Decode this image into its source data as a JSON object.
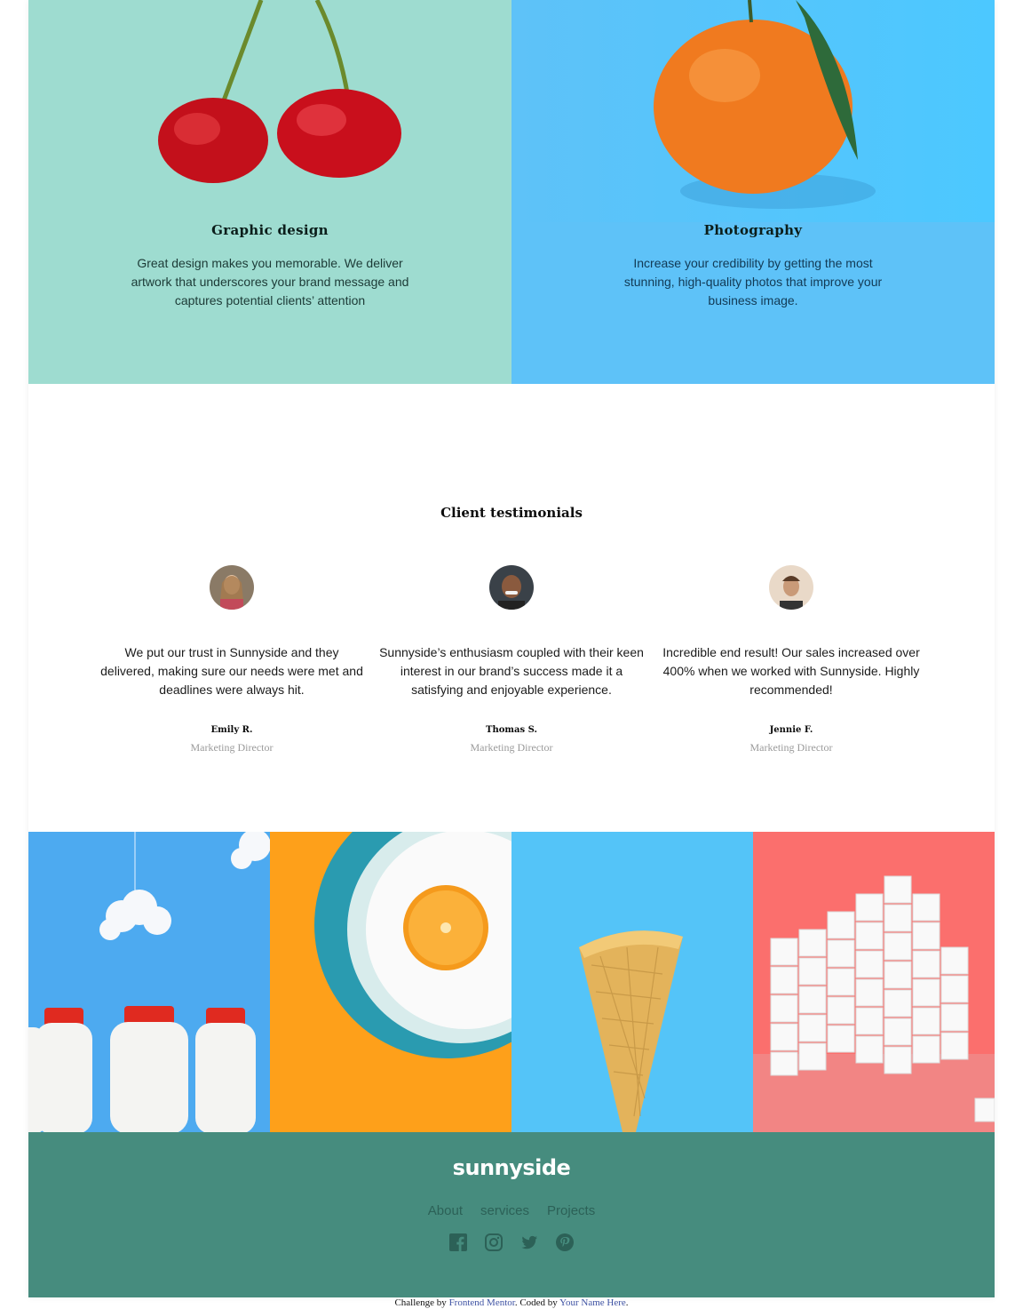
{
  "services": [
    {
      "id": "graphic",
      "title": "Graphic design",
      "text": "Great design makes you memorable. We deliver artwork that underscores your brand message and captures potential clients’ attention",
      "image": "cherries-image",
      "bg_color": "#9edcd0"
    },
    {
      "id": "photo",
      "title": "Photography",
      "text": "Increase your credibility by getting the most stunning, high-quality photos that improve your business image.",
      "image": "orange-image",
      "bg_color": "#5ec2f8"
    }
  ],
  "testimonials": {
    "heading": "Client testimonials",
    "items": [
      {
        "quote": "We put our trust in Sunnyside and they delivered, making sure our needs were met and deadlines were always hit.",
        "name": "Emily R.",
        "role": "Marketing Director"
      },
      {
        "quote": "Sunnyside’s enthusiasm coupled with their keen interest in our brand’s success made it a satisfying and enjoyable experience.",
        "name": "Thomas S.",
        "role": "Marketing Director"
      },
      {
        "quote": "Incredible end result! Our sales increased over 400% when we worked with Sunnyside. Highly recommended!",
        "name": "Jennie F.",
        "role": "Marketing Director"
      }
    ]
  },
  "gallery": [
    "milk-bottles-image",
    "orange-plate-image",
    "ice-cream-cone-image",
    "sugar-cubes-image"
  ],
  "footer": {
    "logo": "sunnyside",
    "nav": [
      "About",
      "services",
      "Projects"
    ],
    "social": [
      "facebook-icon",
      "instagram-icon",
      "twitter-icon",
      "pinterest-icon"
    ],
    "colors": {
      "bg": "#468c7e",
      "nav": "#2c6157"
    }
  },
  "attribution": {
    "prefix": "Challenge by",
    "link1": "Frontend Mentor",
    "middle": ". Coded by",
    "link2": "Your Name Here",
    "suffix": "."
  }
}
